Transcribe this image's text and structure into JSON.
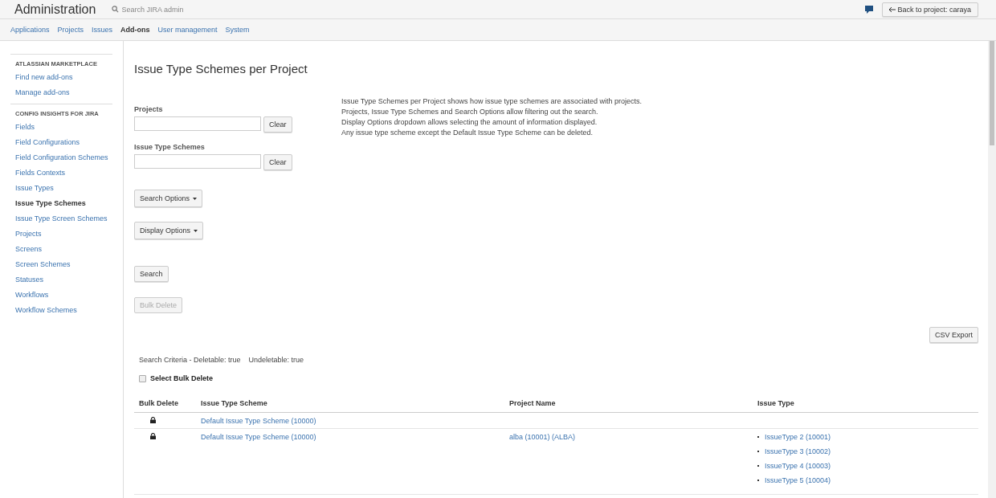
{
  "header": {
    "title": "Administration",
    "search": {
      "placeholder": "Search JIRA admin"
    },
    "back_button": "Back to project: caraya"
  },
  "nav_tabs": [
    {
      "label": "Applications",
      "selected": false
    },
    {
      "label": "Projects",
      "selected": false
    },
    {
      "label": "Issues",
      "selected": false
    },
    {
      "label": "Add-ons",
      "selected": true
    },
    {
      "label": "User management",
      "selected": false
    },
    {
      "label": "System",
      "selected": false
    }
  ],
  "sidebar": {
    "sections": [
      {
        "heading": "ATLASSIAN MARKETPLACE",
        "items": [
          {
            "label": "Find new add-ons",
            "selected": false
          },
          {
            "label": "Manage add-ons",
            "selected": false
          }
        ]
      },
      {
        "heading": "CONFIG INSIGHTS FOR JIRA",
        "items": [
          {
            "label": "Fields",
            "selected": false
          },
          {
            "label": "Field Configurations",
            "selected": false
          },
          {
            "label": "Field Configuration Schemes",
            "selected": false
          },
          {
            "label": "Fields Contexts",
            "selected": false
          },
          {
            "label": "Issue Types",
            "selected": false
          },
          {
            "label": "Issue Type Schemes",
            "selected": true
          },
          {
            "label": "Issue Type Screen Schemes",
            "selected": false
          },
          {
            "label": "Projects",
            "selected": false
          },
          {
            "label": "Screens",
            "selected": false
          },
          {
            "label": "Screen Schemes",
            "selected": false
          },
          {
            "label": "Statuses",
            "selected": false
          },
          {
            "label": "Workflows",
            "selected": false
          },
          {
            "label": "Workflow Schemes",
            "selected": false
          }
        ]
      }
    ]
  },
  "page_title": "Issue Type Schemes per Project",
  "filters": [
    {
      "label": "Projects",
      "clear_button": "Clear"
    },
    {
      "label": "Issue Type Schemes",
      "clear_button": "Clear"
    }
  ],
  "description": [
    "Issue Type Schemes per Project shows how issue type schemes are associated with projects.",
    "Projects, Issue Type Schemes and Search Options allow filtering out the search.",
    "Display Options dropdown allows selecting the amount of information displayed.",
    "Any issue type scheme except the Default Issue Type Scheme can be deleted."
  ],
  "dropdowns": [
    "Search Options",
    "Display Options"
  ],
  "search_button": "Search",
  "bulk_delete_button": {
    "label": "Bulk Delete",
    "disabled": true
  },
  "csv_export_button": "CSV Export",
  "search_criteria": "Search Criteria - Deletable: true    Undeletable: true",
  "select_bulk_delete": {
    "label": "Select Bulk Delete",
    "checked": false
  },
  "table": {
    "columns": [
      "Bulk Delete",
      "Issue Type Scheme",
      "Project Name",
      "Issue Type"
    ],
    "rows": [
      {
        "locked": true,
        "scheme": "Default Issue Type Scheme (10000)",
        "project": "",
        "issue_types": []
      },
      {
        "locked": true,
        "scheme": "Default Issue Type Scheme (10000)",
        "project": "alba (10001) (ALBA)",
        "issue_types": [
          "IssueType 2 (10001)",
          "IssueType 3 (10002)",
          "IssueType 4 (10003)",
          "IssueType 5 (10004)"
        ]
      }
    ]
  }
}
